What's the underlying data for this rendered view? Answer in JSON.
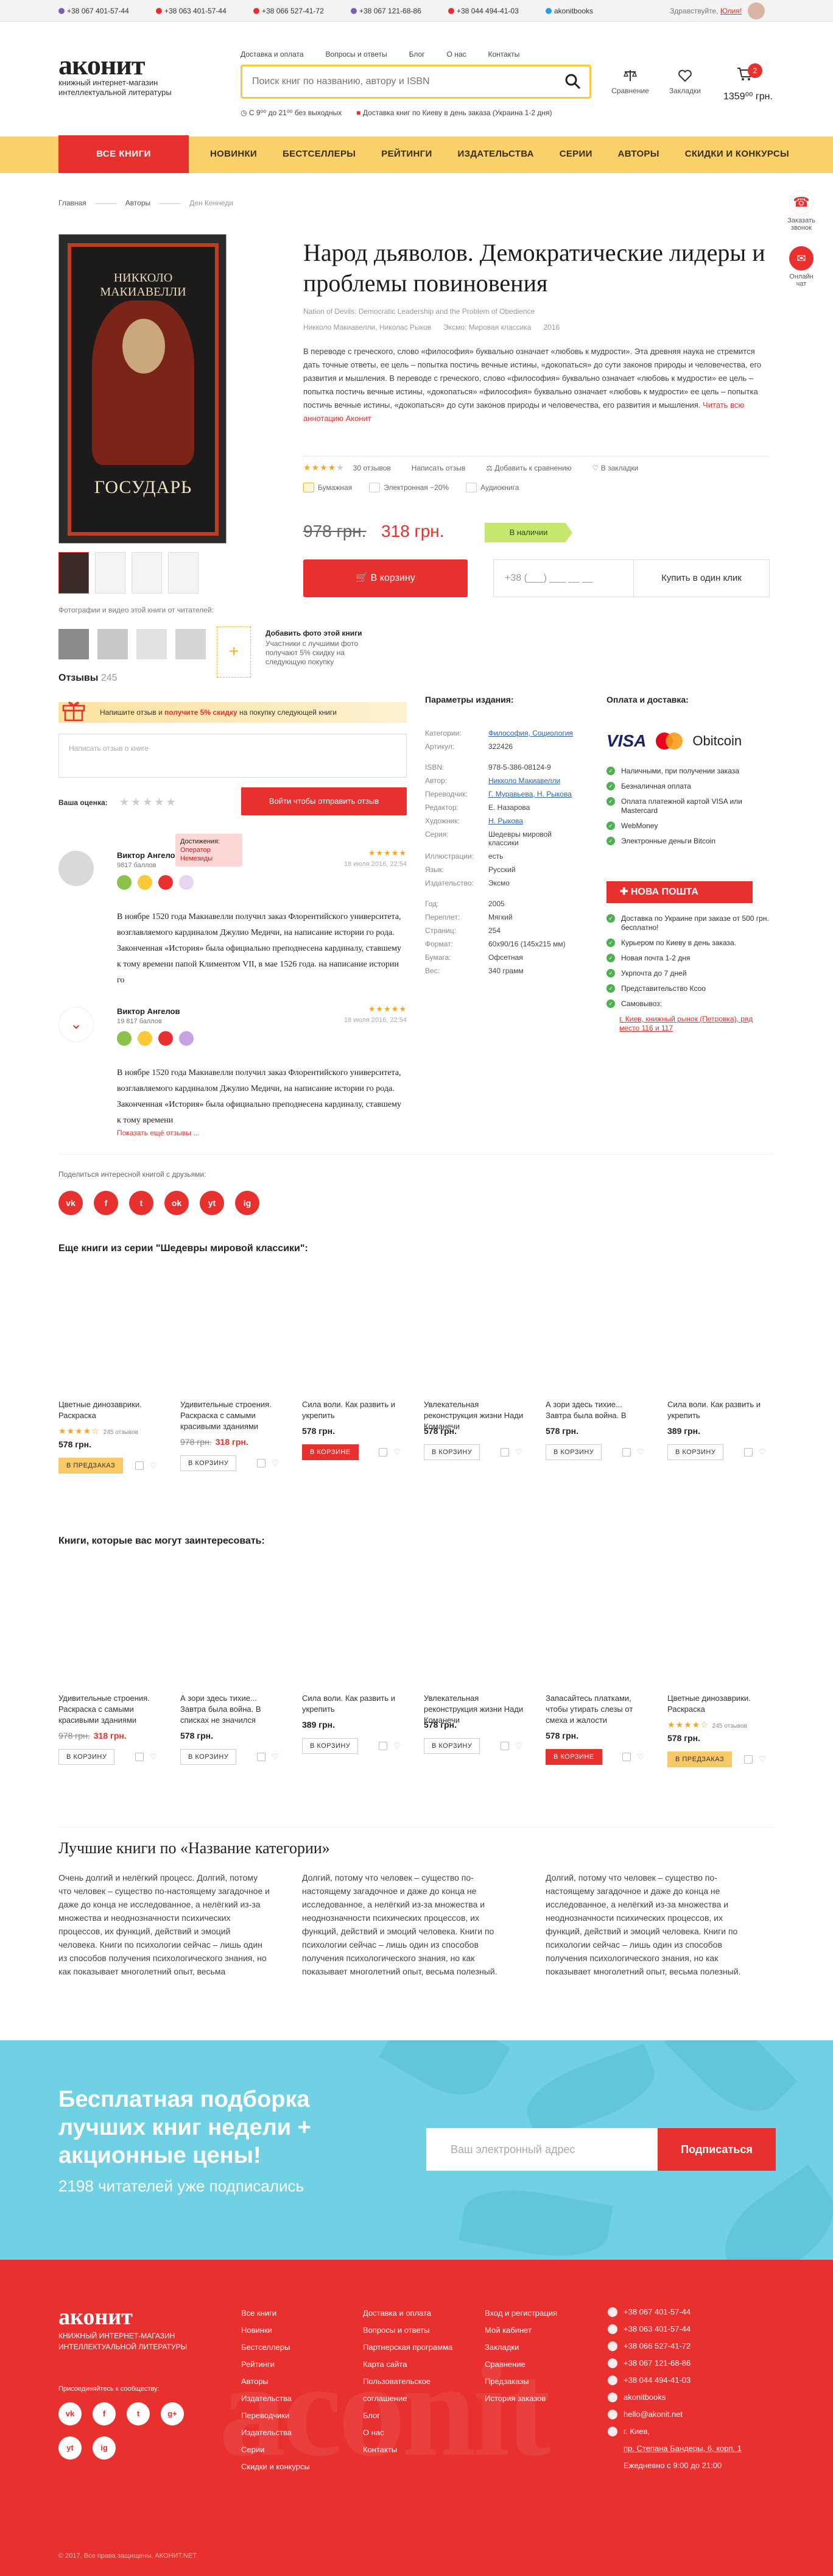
{
  "topbar": {
    "phones": [
      {
        "number": "+38 067 401-57-44",
        "color": "#7d5db8"
      },
      {
        "number": "+38 063 401-57-44",
        "color": "#e8302e"
      },
      {
        "number": "+38 066 527-41-72",
        "color": "#e8302e"
      },
      {
        "number": "+38 067 121-68-86",
        "color": "#7d5db8"
      },
      {
        "number": "+38 044 494-41-03",
        "color": "#e8302e"
      }
    ],
    "skype": "akonitbooks",
    "greeting": "Здравствуйте,",
    "user_name": "Юлия!"
  },
  "header": {
    "logo": "аконит",
    "logo_sub": "книжный интернет-магазин интеллектуальной литературы",
    "search_placeholder": "Поиск книг по названию, автору и ISBN",
    "delivery_hours": "С 9⁰⁰ до 21⁰⁰ без выходных",
    "delivery_kiev": "Доставка книг по Киеву в день заказа (Украина 1-2 дня)",
    "compare_label": "Сравнение",
    "bookmarks_label": "Закладки",
    "cart_count": "2",
    "cart_sum": "1359⁰⁰ грн."
  },
  "top_links": [
    "Доставка и оплата",
    "Вопросы и ответы",
    "Блог",
    "О нас",
    "Контакты"
  ],
  "nav": {
    "all_books": "ВСЕ КНИГИ",
    "items": [
      "НОВИНКИ",
      "БЕСТСЕЛЛЕРЫ",
      "РЕЙТИНГИ",
      "ИЗДАТЕЛЬСТВА",
      "СЕРИИ",
      "АВТОРЫ",
      "СКИДКИ И КОНКУРСЫ"
    ]
  },
  "breadcrumbs": [
    "Главная",
    "Авторы",
    "Ден Кеннеди"
  ],
  "float": {
    "call": "Заказать звонок",
    "chat": "Онлайн чат",
    "call_color": "#e8302e"
  },
  "product": {
    "cover_author": "НИККОЛО МАКИАВЕЛЛИ",
    "cover_title": "ГОСУДАРЬ",
    "title": "Народ дьяволов. Демократические лидеры и проблемы повиновения",
    "original_title": "Nation of Devils: Democratic Leadership and the Problem of Obedience",
    "authors": "Никколо Макиавелли, Николас Рыков",
    "series": "Эксмо: Мировая классика",
    "year": "2016",
    "description": "В переводе с греческого, слово «философия» буквально означает «любовь к мудрости». Эта древняя наука не стремится дать точные ответы, ее цель – попытка постичь вечные истины, «докопаться» до сути законов природы и человечества, его развития и мышления. В переводе с греческого, слово «философия» буквально означает «любовь к мудрости» ее цель – попытка постичь вечные истины, «докопаться» «философия» буквально означает «любовь к мудрости» ее цель – попытка постичь вечные истины, «докопаться» до сути законов природы и человечества, его развития и мышления.",
    "read_more": "Читать всю аннотацию Аконит",
    "rating": 4,
    "reviews_count": "30 отзывов",
    "write_review": "Написать отзыв",
    "add_compare": "Добавить к сравнению",
    "add_bookmarks": "В закладки",
    "formats": [
      "Бумажная",
      "Электронная −20%",
      "Аудиокнига"
    ],
    "old_price": "978 грн.",
    "price": "318 грн.",
    "stock": "В наличии",
    "to_cart": "В корзину",
    "phone_placeholder": "+38 (___) ___ __ __",
    "one_click": "Купить в один клик"
  },
  "photos": {
    "label": "Фотографии и видео этой книги от читателей:",
    "add_title": "Добавить фото этой книги",
    "add_text": "Участники с лучшими фото получают 5% скидку на следующую покупку"
  },
  "reviews": {
    "title": "Отзывы",
    "count": "245",
    "promo_before": "Напишите отзыв и ",
    "promo_bold": "получите 5% скидку",
    "promo_after": " на покупку следующей книги",
    "input_placeholder": "Написать отзыв о книге",
    "your_rating": "Ваша оценка:",
    "send": "Войти чтобы отправить отзыв",
    "tooltip_title": "Достижения:",
    "tooltip_text": "Оператор Немезиды",
    "items": [
      {
        "name": "Виктор Ангелов",
        "points": "9817 баллов",
        "rating": 5,
        "date": "18 июля 2016, 22:54",
        "text": "В ноябре 1520 года Макиавелли получил заказ Флорентийского университета, возглавляемого кардиналом Джулио Медичи, на написание истории го рода. Законченная «История» была официально преподнесена кардиналу, ставшему к тому времени папой Климентом VII, в мае 1526 года. на написание истории го"
      },
      {
        "name": "Виктор Ангелов",
        "points": "19 817 баллов",
        "rating": 5,
        "date": "18 июля 2016, 22:54",
        "text": "В ноябре 1520 года Макиавелли получил заказ Флорентийского университета, возглавляемого кардиналом Джулио Медичи, на написание истории го рода. Законченная «История» была официально преподнесена кардиналу, ставшему к тому времени"
      }
    ],
    "show_all": "Показать ещё отзывы ..."
  },
  "params": {
    "title": "Параметры издания:",
    "rows": [
      {
        "k": "Категории:",
        "v": "Философия, Социология",
        "link": true
      },
      {
        "k": "Артикул:",
        "v": "322426",
        "link": false
      },
      {
        "k": "",
        "v": "",
        "gap": true
      },
      {
        "k": "ISBN:",
        "v": "978-5-386-08124-9",
        "link": false
      },
      {
        "k": "Автор:",
        "v": "Никколо Макиавелли",
        "link": true
      },
      {
        "k": "Переводчик:",
        "v": "Г. Муравьева, Н. Рыкова",
        "link": true
      },
      {
        "k": "Редактор:",
        "v": "Е. Назарова",
        "link": false
      },
      {
        "k": "Художник:",
        "v": "Н. Рыкова",
        "link": true
      },
      {
        "k": "Серия:",
        "v": "Шедевры мировой классики",
        "link": false
      },
      {
        "k": "Иллюстрации:",
        "v": "есть",
        "link": false
      },
      {
        "k": "Язык:",
        "v": "Русский",
        "link": false
      },
      {
        "k": "Издательство:",
        "v": "Эксмо",
        "link": false
      },
      {
        "k": "",
        "v": "",
        "gap": true
      },
      {
        "k": "Год:",
        "v": "2005",
        "link": false
      },
      {
        "k": "Переплет:",
        "v": "Мягкий",
        "link": false
      },
      {
        "k": "Страниц:",
        "v": "254",
        "link": false
      },
      {
        "k": "Формат:",
        "v": "60х90/16 (145х215 мм)",
        "link": false
      },
      {
        "k": "Бумага:",
        "v": "Офсетная",
        "link": false
      },
      {
        "k": "Вес:",
        "v": "340 грамм",
        "link": false
      }
    ]
  },
  "payment": {
    "title": "Оплата и доставка:",
    "logos": [
      "VISA",
      "mastercard",
      "Obitcoin"
    ],
    "pay_list": [
      "Наличными, при получении заказа",
      "Безналичная оплата",
      "Оплата платежной картой VISA или Mastercard",
      "WebMoney",
      "Электронные деньги Bitcoin"
    ],
    "carrier": "НОВА ПОШТА",
    "delivery_list": [
      "Доставка по Украине при заказе от 500 грн. бесплатно!",
      "Курьером по Киеву в день заказа.",
      "Новая почта 1-2 дня",
      "Укрпочта до 7 дней",
      "Представительство Ксоо",
      "Самовывоз:"
    ],
    "pickup": "г. Киев, книжный рынок (Петровка), ряд место 116 и 117"
  },
  "share": {
    "label": "Поделиться интересной книгой с друзьями:",
    "icons": [
      "vk",
      "f",
      "t",
      "ok",
      "yt",
      "ig"
    ]
  },
  "series_books": {
    "title": "Еще книги из серии \"Шедевры мировой классики\":",
    "items": [
      {
        "title": "Цветные динозаврики. Раскраска",
        "rating": 4,
        "reviews": "245 отзывов",
        "old": "",
        "price": "578 грн.",
        "btn": "В ПРЕДЗАКАЗ",
        "btn_style": "yel",
        "cover": "#f4f1ea"
      },
      {
        "title": "Удивительные строения. Раскраска с самыми красивыми зданиями",
        "rating": 0,
        "reviews": "",
        "old": "978 грн.",
        "price": "318 грн.",
        "btn": "В КОРЗИНУ",
        "btn_style": "",
        "cover": "#263b52"
      },
      {
        "title": "Сила воли. Как развить и укрепить",
        "rating": 0,
        "reviews": "",
        "old": "",
        "price": "578 грн.",
        "btn": "В КОРЗИНЕ",
        "btn_style": "red",
        "cover": "#6a5d50"
      },
      {
        "title": "Увлекательная реконструкция жизни Нади Команечи",
        "rating": 0,
        "reviews": "",
        "old": "",
        "price": "578 грн.",
        "btn": "В КОРЗИНУ",
        "btn_style": "",
        "cover": "#d32f2a"
      },
      {
        "title": "А зори здесь тихие... Завтра была война. В",
        "rating": 0,
        "reviews": "",
        "old": "",
        "price": "578 грн.",
        "btn": "В КОРЗИНУ",
        "btn_style": "",
        "cover": "#2d2a28"
      },
      {
        "title": "Сила воли. Как развить и укрепить",
        "rating": 0,
        "reviews": "",
        "old": "",
        "price": "389 грн.",
        "btn": "В КОРЗИНУ",
        "btn_style": "",
        "cover": "#f2efe6"
      }
    ]
  },
  "interest_books": {
    "title": "Книги, которые вас могут заинтересовать:",
    "items": [
      {
        "title": "Удивительные строения. Раскраска с самыми красивыми зданиями",
        "rating": 0,
        "reviews": "",
        "old": "978 грн.",
        "price": "318 грн.",
        "btn": "В КОРЗИНУ",
        "btn_style": "",
        "cover": "#263b52"
      },
      {
        "title": "А зори здесь тихие... Завтра была война. В списках не значился",
        "rating": 0,
        "reviews": "",
        "old": "",
        "price": "578 грн.",
        "btn": "В КОРЗИНУ",
        "btn_style": "",
        "cover": "#2d2a28"
      },
      {
        "title": "Сила воли. Как развить и укрепить",
        "rating": 0,
        "reviews": "",
        "old": "",
        "price": "389 грн.",
        "btn": "В КОРЗИНУ",
        "btn_style": "",
        "cover": "#f2efe6"
      },
      {
        "title": "Увлекательная реконструкция жизни Нади Команечи",
        "rating": 0,
        "reviews": "",
        "old": "",
        "price": "578 грн.",
        "btn": "В КОРЗИНУ",
        "btn_style": "",
        "cover": "#d32f2a"
      },
      {
        "title": "Запасайтесь платками, чтобы утирать слезы от смеха и жалости",
        "rating": 0,
        "reviews": "",
        "old": "",
        "price": "578 грн.",
        "btn": "В КОРЗИНЕ",
        "btn_style": "red",
        "cover": "#6a5d50"
      },
      {
        "title": "Цветные динозаврики. Раскраска",
        "rating": 4,
        "reviews": "245 отзывов",
        "old": "",
        "price": "578 грн.",
        "btn": "В ПРЕДЗАКАЗ",
        "btn_style": "yel",
        "cover": "#f4f1ea"
      }
    ]
  },
  "best": {
    "title": "Лучшие книги по «Название категории»",
    "cols": [
      "Очень долгий и нелёгкий процесс. Долгий, потому что человек – существо по-настоящему загадочное и даже до конца не исследованное, а нелёгкий из-за множества и неоднозначности психических процессов, их функций, действий и эмоций человека. Книги по психологии сейчас – лишь один из способов получения психологического знания, но как показывает многолетний опыт, весьма",
      "Долгий, потому что человек – существо по-настоящему загадочное и даже до конца не исследованное, а нелёгкий из-за множества и неоднозначности психических процессов, их функций, действий и эмоций человека. Книги по психологии сейчас – лишь один из способов получения психологического знания, но как показывает многолетний опыт, весьма полезный.",
      "Долгий, потому что человек – существо по-настоящему загадочное и даже до конца не исследованное, а нелёгкий из-за множества и неоднозначности психических процессов, их функций, действий и эмоций человека. Книги по психологии сейчас – лишь один из способов получения психологического знания, но как показывает многолетний опыт, весьма полезный."
    ]
  },
  "subscribe": {
    "title": "Бесплатная подборка лучших книг недели + акционные цены!",
    "count": "2198 читателей уже подписались",
    "placeholder": "Ваш электронный адрес",
    "button": "Подписаться"
  },
  "footer": {
    "logo": "аконит",
    "sub": "КНИЖНЫЙ ИНТЕРНЕТ-МАГАЗИН ИНТЕЛЛЕКТУАЛЬНОЙ ЛИТЕРАТУРЫ",
    "join": "Присоединяйтесь к сообществу:",
    "social": [
      "vk",
      "f",
      "t",
      "g+",
      "yt",
      "ig"
    ],
    "col1": [
      "Все книги",
      "Новинки",
      "Бестселлеры",
      "Рейтинги",
      "Авторы",
      "Издательства",
      "Переводчики",
      "Издательства",
      "Серии",
      "Скидки и конкурсы"
    ],
    "col2": [
      "Доставка и оплата",
      "Вопросы и ответы",
      "Партнерская программа",
      "Карта сайта",
      "Пользовательское соглашение",
      "Блог",
      "О нас",
      "Контакты"
    ],
    "col3": [
      "Вход и регистрация",
      "Мой кабинет",
      "Закладки",
      "Сравнение",
      "Предзаказы",
      "История заказов"
    ],
    "contacts": [
      "+38 067 401-57-44",
      "+38 063 401-57-44",
      "+38 066 527-41-72",
      "+38 067 121-68-86",
      "+38 044 494-41-03",
      "akonitbooks",
      "hello@akonit.net"
    ],
    "city": "г. Киев,",
    "address": "пр. Степана Бандеры, 6, корп. 1",
    "hours": "Ежедневно с 9:00 до 21:00",
    "copyright": "© 2017. Все права защищены. АКОНИТ.NET",
    "watermark": "aconit"
  }
}
